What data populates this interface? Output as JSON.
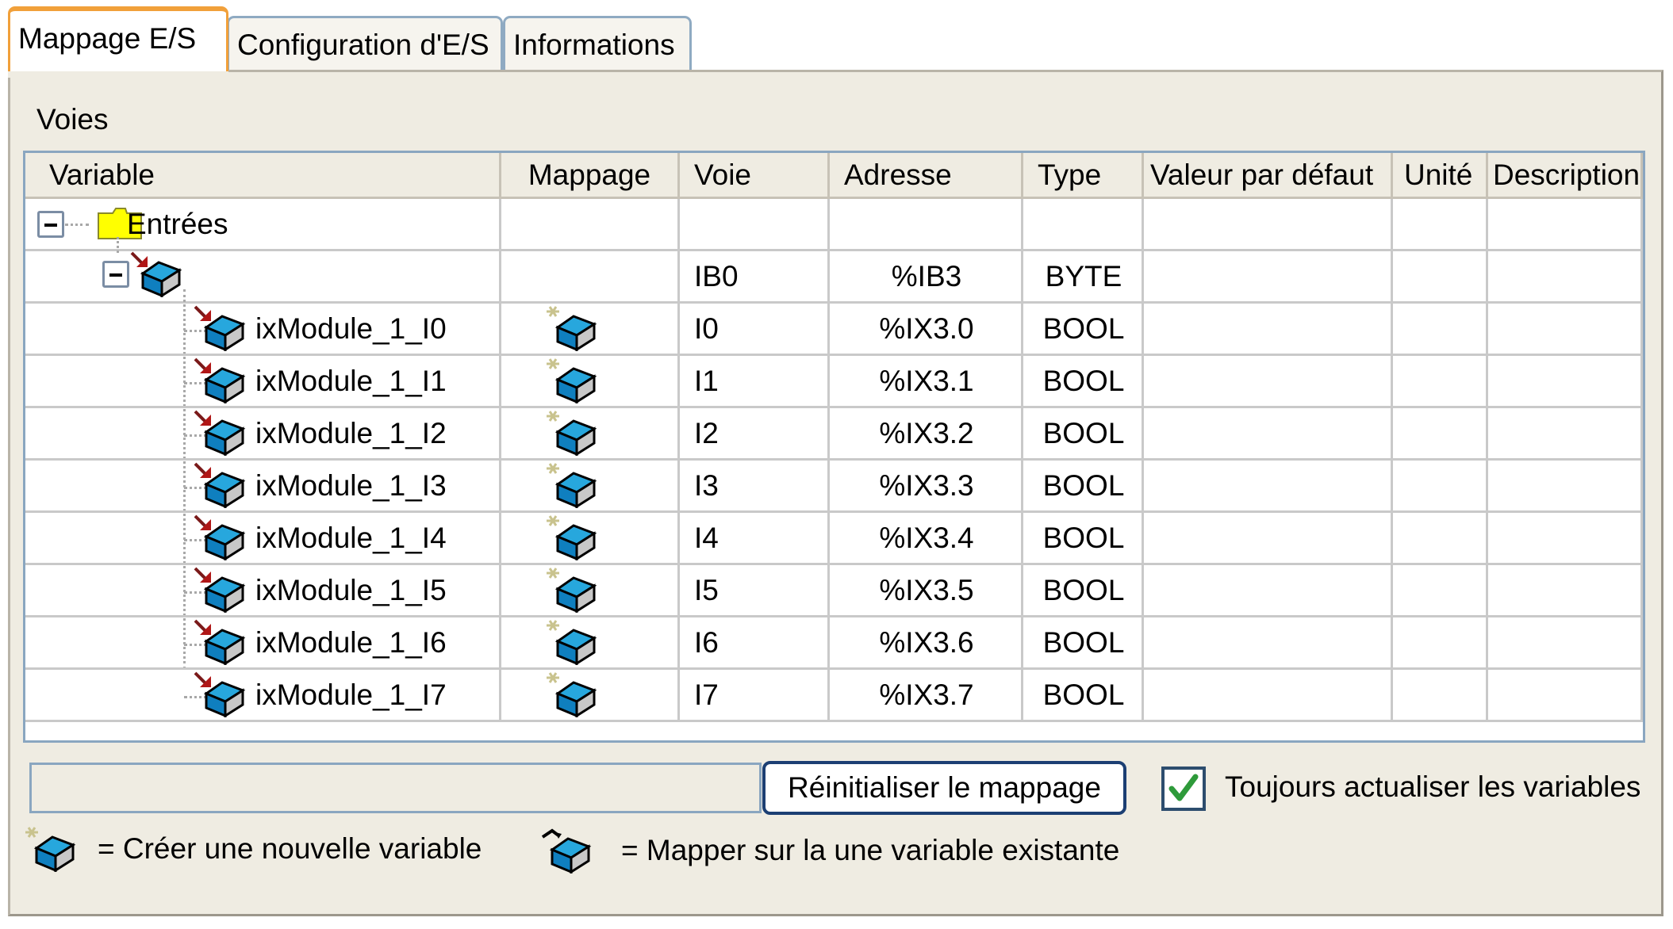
{
  "tabs": [
    {
      "label": "Mappage E/S",
      "active": true
    },
    {
      "label": "Configuration d'E/S",
      "active": false
    },
    {
      "label": "Informations",
      "active": false
    }
  ],
  "section_title": "Voies",
  "columns": {
    "variable": "Variable",
    "mappage": "Mappage",
    "voie": "Voie",
    "adresse": "Adresse",
    "type": "Type",
    "valeur": "Valeur par défaut",
    "unite": "Unité",
    "description": "Description"
  },
  "group": {
    "label": "Entrées"
  },
  "channel_byte": {
    "voie": "IB0",
    "adresse": "%IB3",
    "type": "BYTE"
  },
  "rows": [
    {
      "variable": "ixModule_1_I0",
      "voie": "I0",
      "adresse": "%IX3.0",
      "type": "BOOL"
    },
    {
      "variable": "ixModule_1_I1",
      "voie": "I1",
      "adresse": "%IX3.1",
      "type": "BOOL"
    },
    {
      "variable": "ixModule_1_I2",
      "voie": "I2",
      "adresse": "%IX3.2",
      "type": "BOOL"
    },
    {
      "variable": "ixModule_1_I3",
      "voie": "I3",
      "adresse": "%IX3.3",
      "type": "BOOL"
    },
    {
      "variable": "ixModule_1_I4",
      "voie": "I4",
      "adresse": "%IX3.4",
      "type": "BOOL"
    },
    {
      "variable": "ixModule_1_I5",
      "voie": "I5",
      "adresse": "%IX3.5",
      "type": "BOOL"
    },
    {
      "variable": "ixModule_1_I6",
      "voie": "I6",
      "adresse": "%IX3.6",
      "type": "BOOL"
    },
    {
      "variable": "ixModule_1_I7",
      "voie": "I7",
      "adresse": "%IX3.7",
      "type": "BOOL"
    }
  ],
  "reset_button": "Réinitialiser le mappage",
  "always_update": {
    "label": "Toujours actualiser les variables",
    "checked": true
  },
  "legend": {
    "new_variable": "= Créer une nouvelle variable",
    "existing_variable": "= Mapper sur la une variable existante"
  },
  "colors": {
    "active_tab_accent": "#f1a03a",
    "grid_border": "#8aa6c0",
    "checkmark": "#2e9a3a",
    "folder": "#ffff00",
    "cube_face": "#27a7dd"
  },
  "icons": {
    "folder": "folder-icon",
    "variable": "variable-cube-icon",
    "create_variable": "create-variable-icon",
    "map_existing": "map-existing-variable-icon"
  }
}
